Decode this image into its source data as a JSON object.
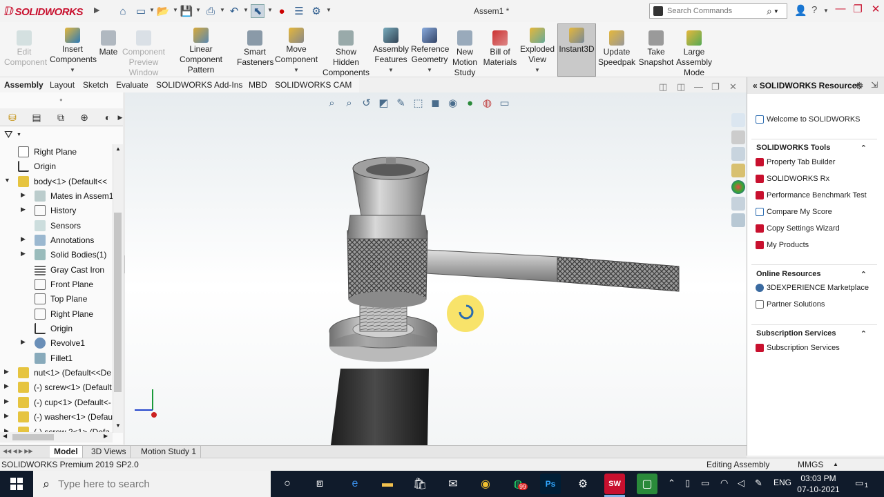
{
  "app": {
    "logo_text": "SOLIDWORKS",
    "document_title": "Assem1 *"
  },
  "quick_access": [
    "home-icon",
    "new-icon",
    "open-icon",
    "save-icon",
    "print-icon",
    "undo-icon",
    "select-icon",
    "rebuild-icon",
    "file-properties-icon",
    "options-icon"
  ],
  "search": {
    "placeholder": "Search Commands"
  },
  "command_manager": {
    "edit_component": "Edit\nComponent",
    "insert_components": "Insert\nComponents",
    "mate": "Mate",
    "component_preview": "Component\nPreview\nWindow",
    "linear_pattern": "Linear Component\nPattern",
    "smart_fasteners": "Smart\nFasteners",
    "move_component": "Move\nComponent",
    "show_hidden": "Show\nHidden\nComponents",
    "assembly_features": "Assembly\nFeatures",
    "reference_geometry": "Reference\nGeometry",
    "new_motion_study": "New\nMotion\nStudy",
    "bill_of_materials": "Bill of\nMaterials",
    "exploded_view": "Exploded\nView",
    "instant3d": "Instant3D",
    "update_speedpak": "Update\nSpeedpak",
    "take_snapshot": "Take\nSnapshot",
    "large_assembly": "Large\nAssembly\nMode"
  },
  "tabs": [
    "Assembly",
    "Layout",
    "Sketch",
    "Evaluate",
    "SOLIDWORKS Add-Ins",
    "MBD",
    "SOLIDWORKS CAM"
  ],
  "tree": [
    {
      "label": "Right Plane"
    },
    {
      "label": "Origin"
    },
    {
      "label": "body<1> (Default<<"
    },
    {
      "label": "Mates in Assem1"
    },
    {
      "label": "History"
    },
    {
      "label": "Sensors"
    },
    {
      "label": "Annotations"
    },
    {
      "label": "Solid Bodies(1)"
    },
    {
      "label": "Gray Cast Iron"
    },
    {
      "label": "Front Plane"
    },
    {
      "label": "Top Plane"
    },
    {
      "label": "Right Plane"
    },
    {
      "label": "Origin"
    },
    {
      "label": "Revolve1"
    },
    {
      "label": "Fillet1"
    },
    {
      "label": "nut<1> (Default<<De"
    },
    {
      "label": "(-) screw<1> (Default"
    },
    {
      "label": "(-) cup<1> (Default<-"
    },
    {
      "label": "(-) washer<1> (Defau"
    },
    {
      "label": "(-) screw 2<1> (Defa"
    }
  ],
  "task_pane": {
    "title": "SOLIDWORKS Resources",
    "welcome": "Welcome to SOLIDWORKS",
    "tools_title": "SOLIDWORKS Tools",
    "tools": [
      "Property Tab Builder",
      "SOLIDWORKS Rx",
      "Performance Benchmark Test",
      "Compare My Score",
      "Copy Settings Wizard",
      "My Products"
    ],
    "online_title": "Online Resources",
    "online": [
      "3DEXPERIENCE Marketplace",
      "Partner Solutions"
    ],
    "subs_title": "Subscription Services",
    "subs": [
      "Subscription Services"
    ]
  },
  "bottom_tabs": [
    "Model",
    "3D Views",
    "Motion Study 1"
  ],
  "status": {
    "version": "SOLIDWORKS Premium 2019 SP2.0",
    "mode": "Editing Assembly",
    "units": "MMGS"
  },
  "taskbar": {
    "search_placeholder": "Type here to search",
    "time": "03:03 PM",
    "date": "07-10-2021",
    "lang": "ENG",
    "notif_count": "1",
    "whatsapp_badge": "99"
  },
  "colors": {
    "brand_red": "#c8102e",
    "taskbar": "#101b2b"
  }
}
